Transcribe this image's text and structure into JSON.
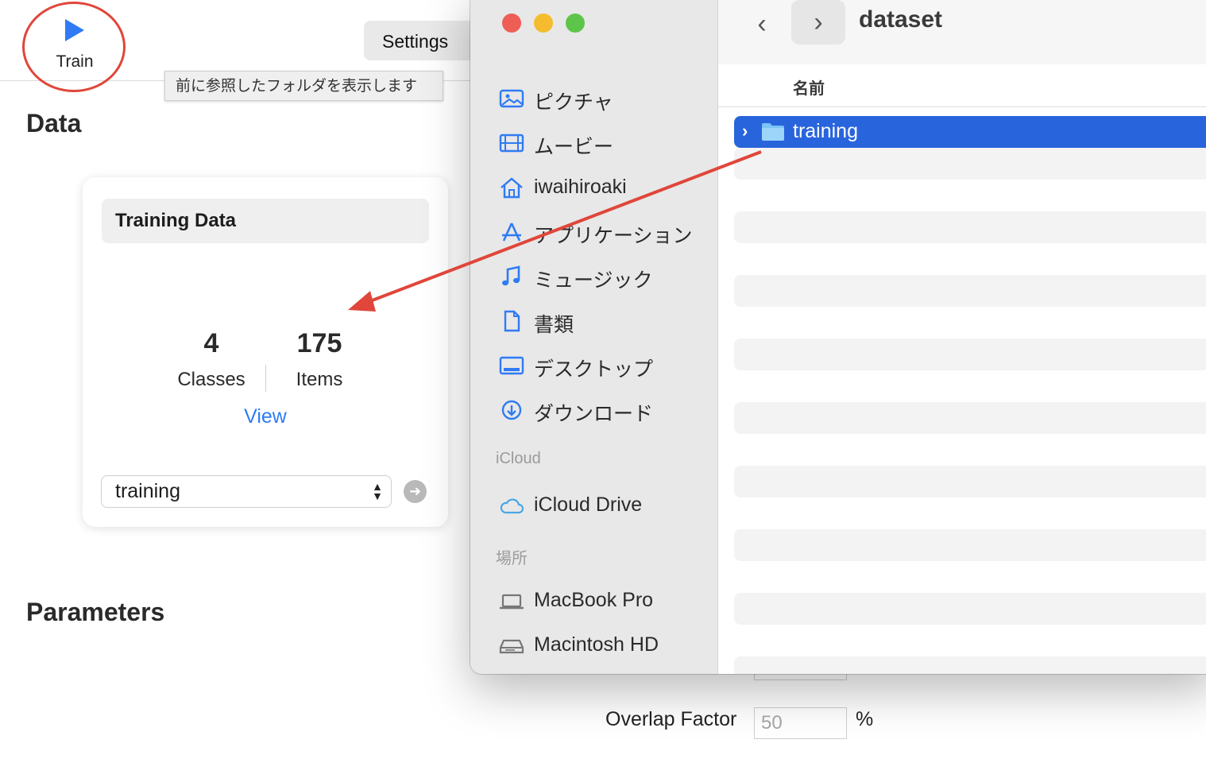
{
  "toolbar": {
    "train_label": "Train",
    "settings_tab": "Settings"
  },
  "tooltip": "前に参照したフォルダを表示します",
  "sections": {
    "data": "Data",
    "parameters": "Parameters"
  },
  "training_card": {
    "title": "Training Data",
    "classes_count": "4",
    "classes_label": "Classes",
    "items_count": "175",
    "items_label": "Items",
    "view_link": "View",
    "source_select_value": "training"
  },
  "parameters": {
    "overlap_label": "Overlap Factor",
    "overlap_value": "50",
    "overlap_unit": "%"
  },
  "file_panel": {
    "current_folder": "dataset",
    "column_name": "名前",
    "sidebar_favorites": [
      {
        "label": "ピクチャ",
        "icon": "photo-icon"
      },
      {
        "label": "ムービー",
        "icon": "film-icon"
      },
      {
        "label": "iwaihiroaki",
        "icon": "home-icon"
      },
      {
        "label": "アプリケーション",
        "icon": "applications-icon"
      },
      {
        "label": "ミュージック",
        "icon": "music-note-icon"
      },
      {
        "label": "書類",
        "icon": "document-icon"
      },
      {
        "label": "デスクトップ",
        "icon": "desktop-icon"
      },
      {
        "label": "ダウンロード",
        "icon": "download-icon"
      }
    ],
    "icloud_header": "iCloud",
    "icloud_items": [
      {
        "label": "iCloud Drive",
        "icon": "cloud-icon"
      }
    ],
    "locations_header": "場所",
    "location_items": [
      {
        "label": "MacBook Pro",
        "icon": "laptop-icon"
      },
      {
        "label": "Macintosh HD",
        "icon": "hard-drive-icon"
      }
    ],
    "files": [
      {
        "name": "training",
        "selected": true
      }
    ]
  },
  "colors": {
    "accent": "#2f7bf5",
    "selection": "#2864dc",
    "annotation": "#e0463a"
  }
}
